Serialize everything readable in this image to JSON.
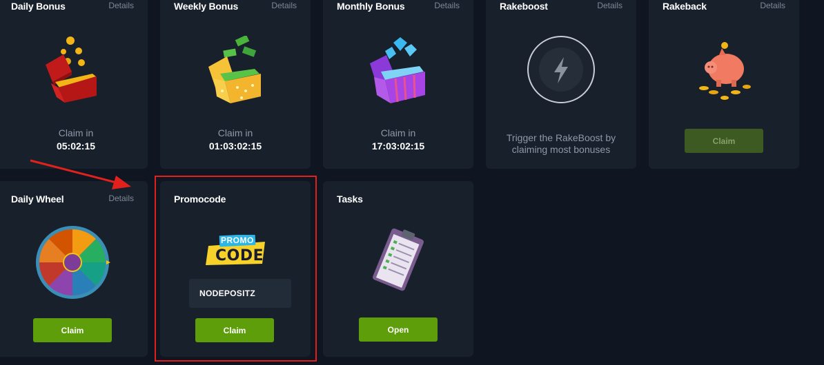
{
  "cards": {
    "daily_bonus": {
      "title": "Daily Bonus",
      "details": "Details",
      "claim_in": "Claim in",
      "time": "05:02:15"
    },
    "weekly_bonus": {
      "title": "Weekly Bonus",
      "details": "Details",
      "claim_in": "Claim in",
      "time": "01:03:02:15"
    },
    "monthly_bonus": {
      "title": "Monthly Bonus",
      "details": "Details",
      "claim_in": "Claim in",
      "time": "17:03:02:15"
    },
    "rakeboost": {
      "title": "Rakeboost",
      "details": "Details",
      "text_line1": "Trigger the RakeBoost by",
      "text_line2": "claiming most bonuses"
    },
    "rakeback": {
      "title": "Rakeback",
      "details": "Details",
      "button": "Claim"
    },
    "daily_wheel": {
      "title": "Daily Wheel",
      "details": "Details",
      "button": "Claim"
    },
    "promocode": {
      "title": "Promocode",
      "badge_top": "PROMO",
      "badge_bottom": "CODE",
      "input_value": "NODEPOSITZ",
      "button": "Claim"
    },
    "tasks": {
      "title": "Tasks",
      "button": "Open"
    }
  },
  "colors": {
    "accent_green": "#5e9e0a",
    "highlight_red": "#e3211c",
    "card_bg": "#18202c",
    "page_bg": "#0f1622"
  }
}
